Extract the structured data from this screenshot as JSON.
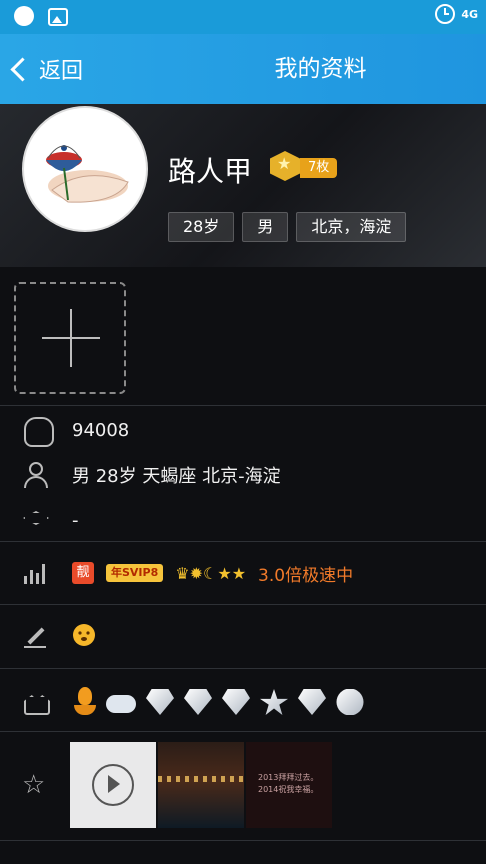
{
  "status_bar": {
    "network": "4G"
  },
  "title_bar": {
    "back_label": "返回",
    "title": "我的资料"
  },
  "profile": {
    "name": "路人甲",
    "medal_count": "7枚",
    "tags": [
      "28岁",
      "男",
      "北京，海淀"
    ]
  },
  "info": {
    "qq_number": "94008",
    "basic": "男  28岁  天蝎座  北京-海淀",
    "school": "-"
  },
  "privileges": {
    "badge_liang": "靓",
    "svip_badge": "年SVIP8",
    "speed_text": "3.0倍极速中"
  },
  "photos": {
    "thumb3_line1": "2013拜拜过去。",
    "thumb3_line2": "2014祝我幸福。"
  }
}
